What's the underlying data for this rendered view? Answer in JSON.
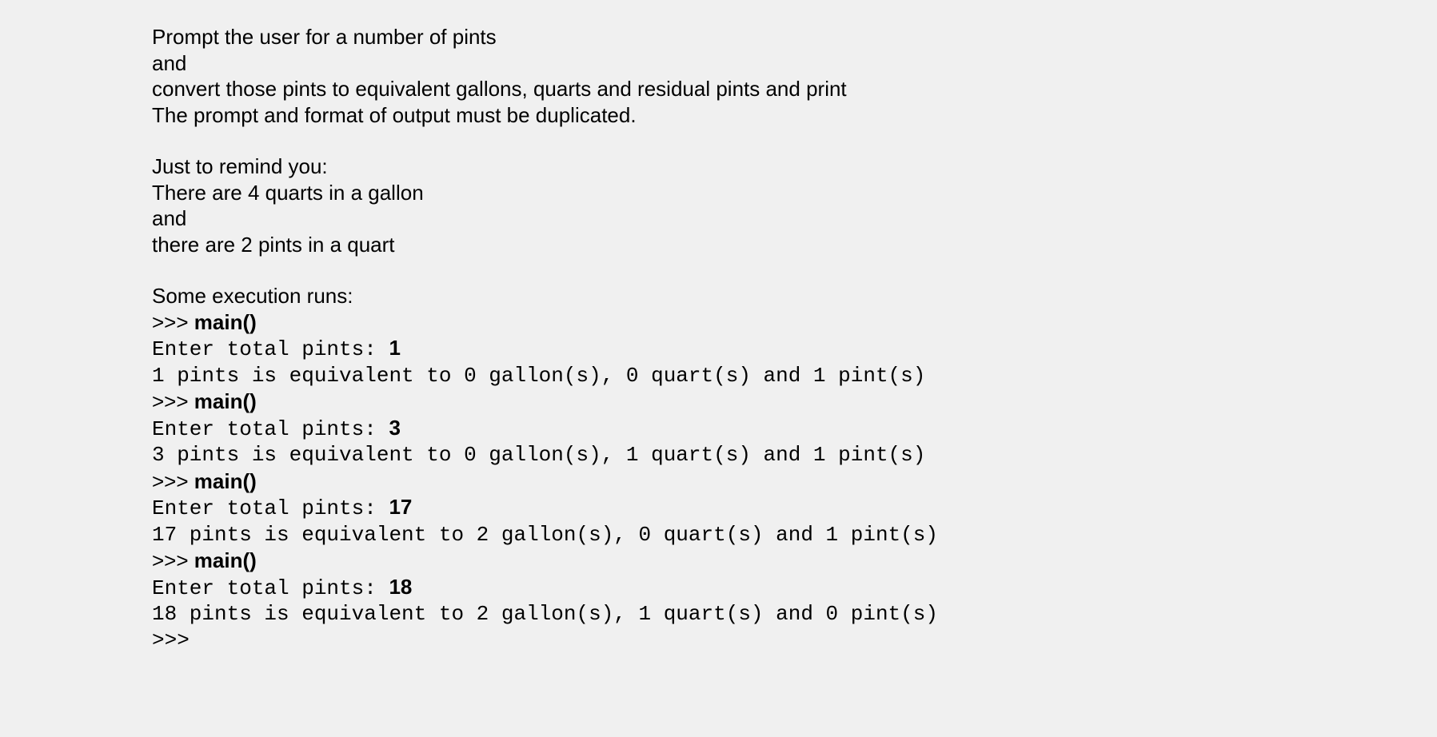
{
  "paragraph1": {
    "line1": "Prompt the user for a number of pints",
    "line2": "and",
    "line3": "convert those pints to equivalent gallons, quarts and residual pints and print",
    "line4": "The prompt and format of output must be duplicated."
  },
  "paragraph2": {
    "line1": "Just to remind you:",
    "line2": "There are 4 quarts in a gallon",
    "line3": "and",
    "line4": "there are 2 pints in a quart"
  },
  "executions": {
    "intro": "Some execution runs:",
    "prompt_prefix": ">>> ",
    "main_call": "main()",
    "enter_prompt": "Enter total pints: ",
    "final_prompt": ">>>",
    "runs": [
      {
        "input": "1",
        "output": "1 pints is equivalent to 0 gallon(s), 0 quart(s) and 1 pint(s)"
      },
      {
        "input": "3",
        "output": "3 pints is equivalent to 0 gallon(s), 1 quart(s) and 1 pint(s)"
      },
      {
        "input": "17",
        "output": "17 pints is equivalent to 2 gallon(s), 0 quart(s) and 1 pint(s)"
      },
      {
        "input": "18",
        "output": "18 pints is equivalent to 2 gallon(s), 1 quart(s) and 0 pint(s)"
      }
    ]
  }
}
